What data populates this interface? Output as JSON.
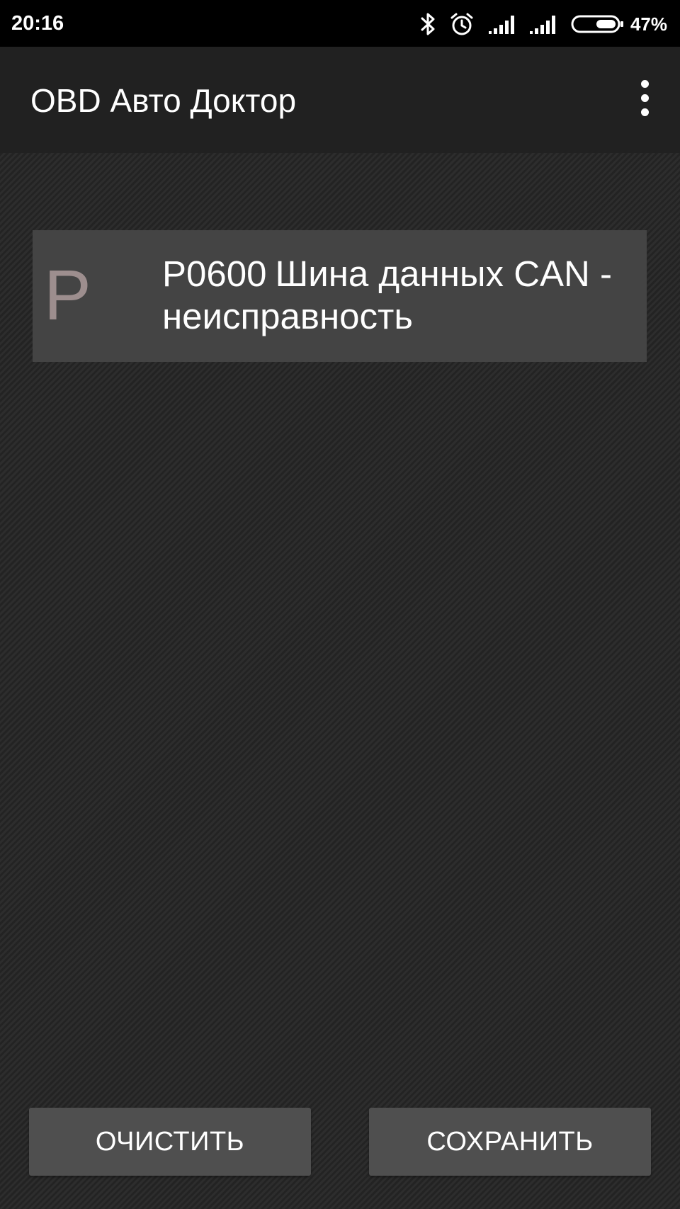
{
  "status_bar": {
    "time": "20:16",
    "battery_percent": "47%",
    "icons": [
      "bluetooth-icon",
      "alarm-icon",
      "signal-icon",
      "signal-icon",
      "battery-icon"
    ]
  },
  "app_bar": {
    "title": "OBD Авто Доктор",
    "overflow_icon": "more-vert-icon"
  },
  "dtc_list": [
    {
      "letter": "P",
      "code": "P0600",
      "description": "Шина данных CAN - неисправность"
    }
  ],
  "buttons": {
    "clear_label": "ОЧИСТИТЬ",
    "save_label": "СОХРАНИТЬ"
  },
  "colors": {
    "status_bar_bg": "#000000",
    "app_bar_bg": "#212121",
    "card_bg": "#444444",
    "letter_color": "#9d8e8e",
    "button_bg": "#4f4f4f"
  }
}
